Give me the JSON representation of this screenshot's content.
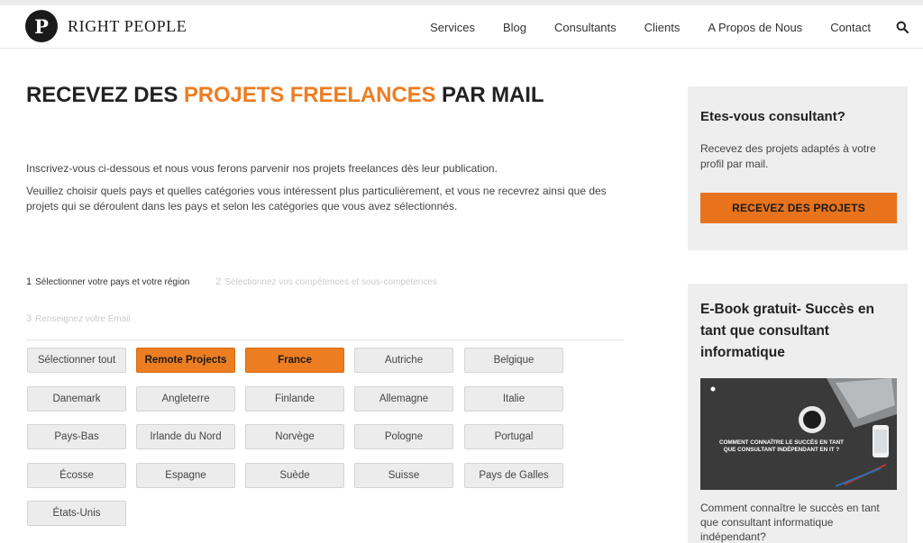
{
  "header": {
    "logo_mark": "P",
    "logo_text": "RIGHT PEOPLE",
    "nav": [
      "Services",
      "Blog",
      "Consultants",
      "Clients",
      "A Propos de Nous",
      "Contact"
    ]
  },
  "main": {
    "headline_part1": "RECEVEZ DES ",
    "headline_accent": "PROJETS FREELANCES",
    "headline_part2": " PAR MAIL",
    "intro_p1": "Inscrivez-vous ci-dessous et nous vous ferons parvenir nos projets freelances dès leur publication.",
    "intro_p2": "Veuillez choisir quels pays et quelles catégories vous intéressent plus particulièrement, et vous ne recevrez ainsi que des projets qui se déroulent dans les pays et selon les catégories que vous avez sélectionnés.",
    "steps": [
      {
        "num": "1",
        "label": "Sélectionner votre pays et votre région"
      },
      {
        "num": "2",
        "label": "Sélectionnez vos compétences et sous-compétences"
      },
      {
        "num": "3",
        "label": "Renseignez votre Email"
      }
    ],
    "options": [
      {
        "label": "Sélectionner tout",
        "selected": false
      },
      {
        "label": "Remote Projects",
        "selected": true
      },
      {
        "label": "France",
        "selected": true
      },
      {
        "label": "Autriche",
        "selected": false
      },
      {
        "label": "Belgique",
        "selected": false
      },
      {
        "label": "Danemark",
        "selected": false
      },
      {
        "label": "Angleterre",
        "selected": false
      },
      {
        "label": "Finlande",
        "selected": false
      },
      {
        "label": "Allemagne",
        "selected": false
      },
      {
        "label": "Italie",
        "selected": false
      },
      {
        "label": "Pays-Bas",
        "selected": false
      },
      {
        "label": "Irlande du Nord",
        "selected": false
      },
      {
        "label": "Norvège",
        "selected": false
      },
      {
        "label": "Pologne",
        "selected": false
      },
      {
        "label": "Portugal",
        "selected": false
      },
      {
        "label": "Écosse",
        "selected": false
      },
      {
        "label": "Espagne",
        "selected": false
      },
      {
        "label": "Suède",
        "selected": false
      },
      {
        "label": "Suisse",
        "selected": false
      },
      {
        "label": "Pays de Galles",
        "selected": false
      },
      {
        "label": "États-Unis",
        "selected": false
      }
    ]
  },
  "sidebar": {
    "card1_title": "Etes-vous consultant?",
    "card1_text": "Recevez des projets adaptés à votre profil par mail.",
    "card1_button": "RECEVEZ DES PROJETS",
    "card2_title": "E-Book gratuit- Succès en tant que consultant informatique",
    "ebook_title": "COMMENT CONNAÎTRE LE SUCCÈS EN TANT QUE CONSULTANT INDÉPENDANT EN IT ?",
    "card2_text": "Comment connaître le succès en tant que consultant informatique indépendant?"
  },
  "colors": {
    "accent": "#ed7d21",
    "button_bg": "#ececec",
    "sidebar_bg": "#eeeeee"
  }
}
